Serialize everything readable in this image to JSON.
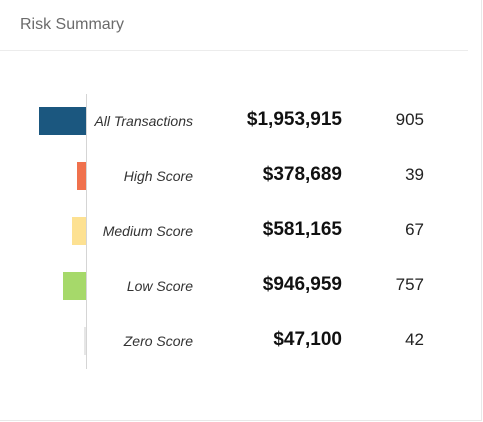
{
  "card": {
    "title": "Risk Summary"
  },
  "chart_data": {
    "type": "bar",
    "orientation": "horizontal",
    "title": "Risk Summary",
    "categories": [
      "All Transactions",
      "High Score",
      "Medium Score",
      "Low Score",
      "Zero Score"
    ],
    "amounts": [
      "$1,953,915",
      "$378,689",
      "$581,165",
      "$946,959",
      "$47,100"
    ],
    "counts": [
      "905",
      "39",
      "67",
      "757",
      "42"
    ],
    "series": [
      {
        "values": [
          1953915,
          378689,
          581165,
          946959,
          47100
        ]
      }
    ],
    "colors": [
      "#1b577f",
      "#f0714d",
      "#fde192",
      "#a6d96a",
      "#e6e6e6"
    ],
    "xlim": [
      0,
      1953915
    ],
    "grid": false
  }
}
